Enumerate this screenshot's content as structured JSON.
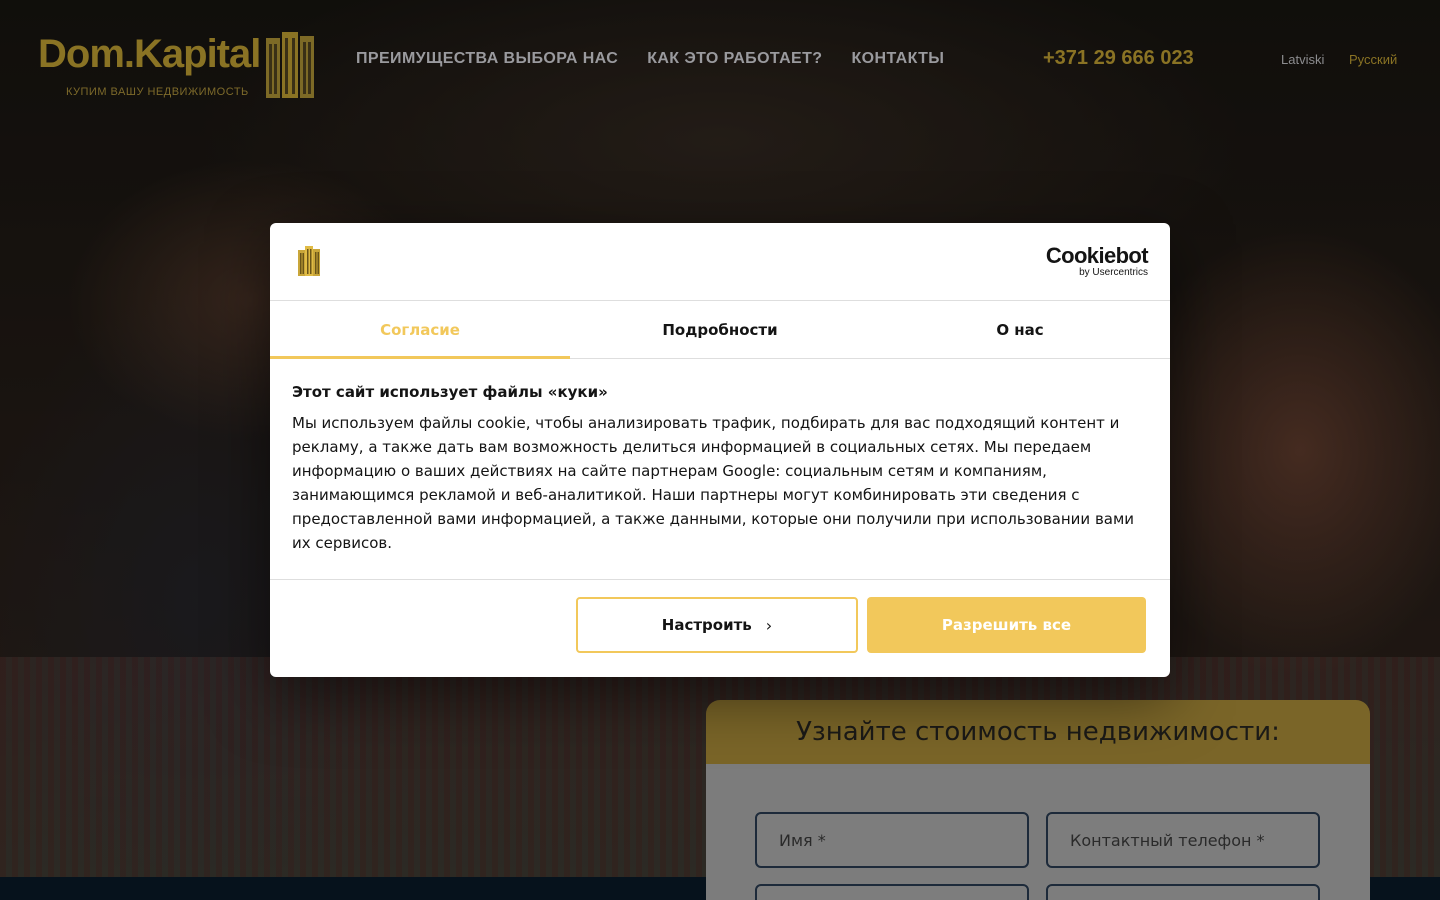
{
  "header": {
    "logo_text": "Dom.Kapital",
    "logo_tagline": "КУПИМ ВАШУ НЕДВИЖИМОСТЬ",
    "nav": [
      {
        "label": "ПРЕИМУЩЕСТВА ВЫБОРА НАС"
      },
      {
        "label": "КАК ЭТО РАБОТАЕТ?"
      },
      {
        "label": "КОНТАКТЫ"
      }
    ],
    "phone": "+371 29 666 023",
    "languages": [
      {
        "label": "Latviski"
      },
      {
        "label": "Русский"
      }
    ]
  },
  "form": {
    "title": "Узнайте стоимость недвижимости:",
    "name_placeholder": "Имя *",
    "phone_placeholder": "Контактный телефон *"
  },
  "cookie_dialog": {
    "brand_name": "Cookiebot",
    "brand_by": "by Usercentrics",
    "tabs": [
      {
        "label": "Согласие"
      },
      {
        "label": "Подробности"
      },
      {
        "label": "О нас"
      }
    ],
    "title": "Этот сайт использует файлы «куки»",
    "text": "Мы используем файлы cookie, чтобы анализировать трафик, подбирать для вас подходящий контент и рекламу, а также дать вам возможность делиться информацией в социальных сетях. Мы передаем информацию о ваших действиях на сайте партнерам Google: социальным сетям и компаниям, занимающимся рекламой и веб-аналитикой. Наши партнеры могут комбинировать эти сведения с предоставленной вами информацией, а также данными, которые они получили при использовании вами их сервисов.",
    "customize_label": "Настроить",
    "allow_all_label": "Разрешить все"
  },
  "colors": {
    "accent": "#f2c85b",
    "brand_gold": "#8a7324"
  },
  "icons": {
    "logo": "building-icon",
    "chevron": "chevron-right-icon"
  }
}
